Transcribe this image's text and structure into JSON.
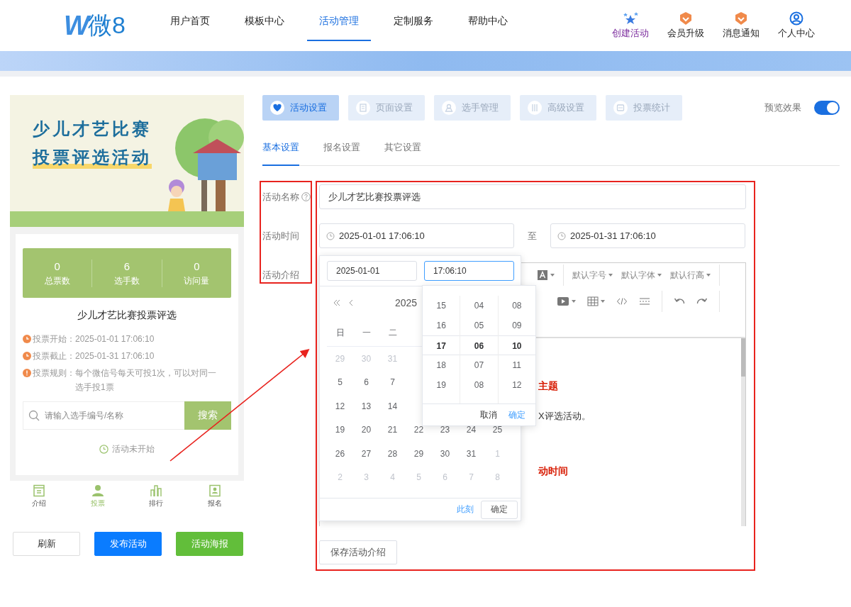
{
  "header": {
    "logo": {
      "mark": "W",
      "text": "微8"
    },
    "nav": [
      {
        "label": "用户首页",
        "selected": false
      },
      {
        "label": "模板中心",
        "selected": false
      },
      {
        "label": "活动管理",
        "selected": true
      },
      {
        "label": "定制服务",
        "selected": false
      },
      {
        "label": "帮助中心",
        "selected": false
      }
    ],
    "actions": [
      {
        "label": "创建活动",
        "kind": "star"
      },
      {
        "label": "会员升级",
        "kind": "badge"
      },
      {
        "label": "消息通知",
        "kind": "badge"
      },
      {
        "label": "个人中心",
        "kind": "user"
      }
    ]
  },
  "preview": {
    "banner": {
      "lines": [
        "少儿才艺比赛",
        "投票评选活动"
      ]
    },
    "stats": [
      {
        "value": "0",
        "label": "总票数"
      },
      {
        "value": "6",
        "label": "选手数"
      },
      {
        "value": "0",
        "label": "访问量"
      }
    ],
    "title": "少儿才艺比赛投票评选",
    "info": [
      {
        "kind": "clock",
        "label": "投票开始：",
        "value": "2025-01-01 17:06:10"
      },
      {
        "kind": "clock",
        "label": "投票截止：",
        "value": "2025-01-31 17:06:10"
      },
      {
        "kind": "alert",
        "label": "投票规则：",
        "value": "每个微信号每天可投1次，可以对同一选手投1票"
      }
    ],
    "search": {
      "placeholder": "请输入选手编号/名称",
      "button": "搜索"
    },
    "status": "活动未开始",
    "bottom_nav": [
      {
        "kind": "doc",
        "label": "介绍",
        "selected": false
      },
      {
        "kind": "person",
        "label": "投票",
        "selected": true
      },
      {
        "kind": "chart",
        "label": "排行",
        "selected": false
      },
      {
        "kind": "card",
        "label": "报名",
        "selected": false
      }
    ]
  },
  "preview_actions": [
    {
      "kind": "default",
      "label": "刷新"
    },
    {
      "kind": "primary",
      "label": "发布活动"
    },
    {
      "kind": "success",
      "label": "活动海报"
    }
  ],
  "tabs": [
    {
      "kind": "heart",
      "label": "活动设置",
      "selected": true
    },
    {
      "kind": "page",
      "label": "页面设置",
      "selected": false
    },
    {
      "kind": "person",
      "label": "选手管理",
      "selected": false
    },
    {
      "kind": "sliders",
      "label": "高级设置",
      "selected": false
    },
    {
      "kind": "stats",
      "label": "投票统计",
      "selected": false
    }
  ],
  "preview_toggle": {
    "label": "预览效果",
    "on": true
  },
  "subtabs": [
    {
      "label": "基本设置",
      "selected": true
    },
    {
      "label": "报名设置",
      "selected": false
    },
    {
      "label": "其它设置",
      "selected": false
    }
  ],
  "form": {
    "name": {
      "label": "活动名称",
      "value": "少儿才艺比赛投票评选"
    },
    "time": {
      "label": "活动时间",
      "start": "2025-01-01 17:06:10",
      "separator": "至",
      "end": "2025-01-31 17:06:10"
    },
    "intro": {
      "label": "活动介绍"
    },
    "save_button": "保存活动介绍"
  },
  "editor": {
    "toolbar_row1": [
      {
        "kind": "font-color"
      },
      {
        "kind": "divider"
      },
      {
        "kind": "dropdown",
        "label": "默认字号"
      },
      {
        "kind": "dropdown",
        "label": "默认字体"
      },
      {
        "kind": "dropdown",
        "label": "默认行高"
      },
      {
        "kind": "divider"
      }
    ],
    "toolbar_row2": [
      {
        "kind": "video"
      },
      {
        "kind": "table"
      },
      {
        "kind": "code"
      },
      {
        "kind": "rule"
      },
      {
        "kind": "divider"
      },
      {
        "kind": "undo"
      },
      {
        "kind": "redo"
      },
      {
        "kind": "divider"
      }
    ],
    "content": [
      {
        "kind": "heading",
        "text": "主题"
      },
      {
        "kind": "paragraph",
        "text": "X评选活动。"
      },
      {
        "kind": "heading",
        "text": "动时间"
      }
    ]
  },
  "date_picker": {
    "date_input": "2025-01-01",
    "time_input": "17:06:10",
    "year": "2025",
    "weekdays": [
      "日",
      "一",
      "二"
    ],
    "weeks": [
      [
        {
          "day": "29",
          "muted": true
        },
        {
          "day": "30",
          "muted": true
        },
        {
          "day": "31",
          "muted": true
        }
      ],
      [
        {
          "day": "5",
          "muted": false
        },
        {
          "day": "6",
          "muted": false
        },
        {
          "day": "7",
          "muted": false
        }
      ],
      [
        {
          "day": "12",
          "muted": false
        },
        {
          "day": "13",
          "muted": false
        },
        {
          "day": "14",
          "muted": false
        }
      ],
      [
        {
          "day": "19",
          "muted": false
        },
        {
          "day": "20",
          "muted": false
        },
        {
          "day": "21",
          "muted": false
        },
        {
          "day": "22",
          "muted": false
        },
        {
          "day": "23",
          "muted": false
        },
        {
          "day": "24",
          "muted": false
        },
        {
          "day": "25",
          "muted": false
        }
      ],
      [
        {
          "day": "26",
          "muted": false
        },
        {
          "day": "27",
          "muted": false
        },
        {
          "day": "28",
          "muted": false
        },
        {
          "day": "29",
          "muted": false
        },
        {
          "day": "30",
          "muted": false
        },
        {
          "day": "31",
          "muted": false
        },
        {
          "day": "1",
          "muted": true
        }
      ],
      [
        {
          "day": "2",
          "muted": true
        },
        {
          "day": "3",
          "muted": true
        },
        {
          "day": "4",
          "muted": true
        },
        {
          "day": "5",
          "muted": true
        },
        {
          "day": "6",
          "muted": true
        },
        {
          "day": "7",
          "muted": true
        },
        {
          "day": "8",
          "muted": true
        }
      ]
    ],
    "now": "此刻",
    "ok": "确定"
  },
  "time_panel": {
    "columns": [
      [
        {
          "text": "15",
          "selected": false
        },
        {
          "text": "16",
          "selected": false
        },
        {
          "text": "17",
          "selected": true
        },
        {
          "text": "18",
          "selected": false
        },
        {
          "text": "19",
          "selected": false
        }
      ],
      [
        {
          "text": "04",
          "selected": false
        },
        {
          "text": "05",
          "selected": false
        },
        {
          "text": "06",
          "selected": true
        },
        {
          "text": "07",
          "selected": false
        },
        {
          "text": "08",
          "selected": false
        }
      ],
      [
        {
          "text": "08",
          "selected": false
        },
        {
          "text": "09",
          "selected": false
        },
        {
          "text": "10",
          "selected": true
        },
        {
          "text": "11",
          "selected": false
        },
        {
          "text": "12",
          "selected": false
        }
      ]
    ],
    "cancel": "取消",
    "ok": "确定"
  }
}
